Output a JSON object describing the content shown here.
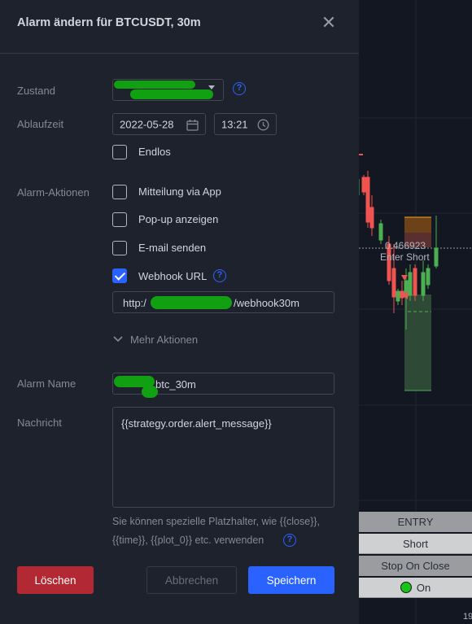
{
  "dialog": {
    "title": "Alarm ändern für BTCUSDT, 30m",
    "zustand_label": "Zustand",
    "ablaufzeit_label": "Ablaufzeit",
    "date_value": "2022-05-28",
    "time_value": "13:21",
    "endlos_label": "Endlos",
    "actions_label": "Alarm-Aktionen",
    "actions": [
      {
        "label": "Mitteilung via App",
        "checked": false
      },
      {
        "label": "Pop-up anzeigen",
        "checked": false
      },
      {
        "label": "E-mail senden",
        "checked": false
      },
      {
        "label": "Webhook URL",
        "checked": true
      }
    ],
    "webhook_prefix": "http:/",
    "webhook_suffix": "/webhook30m",
    "mehr_aktionen": "Mehr Aktionen",
    "alarm_name_label": "Alarm Name",
    "alarm_name_suffix": "btc_30m",
    "nachricht_label": "Nachricht",
    "nachricht_value": "{{strategy.order.alert_message}}",
    "hint_line1": "Sie können spezielle Platzhalter, wie {{close}},",
    "hint_line2": "{{time}}, {{plot_0}} etc. verwenden",
    "delete_label": "Löschen",
    "cancel_label": "Abbrechen",
    "save_label": "Speichern"
  },
  "chart": {
    "price_label": "0.466923",
    "signal_label": "Enter Short",
    "info_rows": [
      "ENTRY",
      "Short",
      "Stop On Close",
      "On"
    ],
    "axis_label": "19"
  },
  "colors": {
    "accent": "#2962ff",
    "delete": "#b22833",
    "up_candle": "#4caf50",
    "down_candle": "#f05350"
  }
}
